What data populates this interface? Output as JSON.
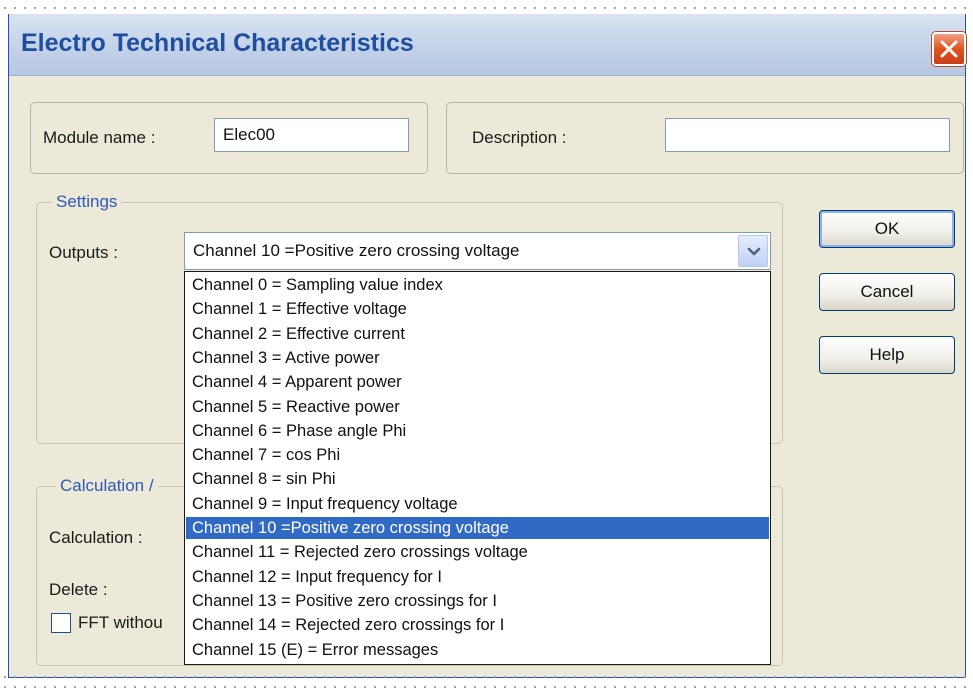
{
  "window": {
    "title": "Electro Technical Characteristics"
  },
  "module": {
    "name_label": "Module name :",
    "name_value": "Elec00",
    "description_label": "Description :",
    "description_value": ""
  },
  "settings": {
    "legend": "Settings",
    "outputs_label": "Outputs :",
    "selected_output": "Channel 10 =Positive zero crossing voltage"
  },
  "dropdown": {
    "items": [
      "Channel 0 = Sampling value index",
      "Channel 1 = Effective voltage",
      "Channel 2 = Effective current",
      "Channel 3 = Active power",
      "Channel 4 = Apparent power",
      "Channel 5 = Reactive power",
      "Channel 6 = Phase angle Phi",
      "Channel 7 = cos Phi",
      "Channel 8 = sin Phi",
      "Channel 9 = Input frequency voltage",
      "Channel 10 =Positive zero crossing voltage",
      "Channel 11 = Rejected zero crossings voltage",
      "Channel 12 = Input frequency for I",
      "Channel 13 = Positive zero crossings for I",
      "Channel 14 = Rejected zero crossings for I",
      "Channel 15 (E) = Error messages"
    ],
    "selected_index": 10
  },
  "calculation": {
    "legend_partial": "Calculation /",
    "calculation_label": "Calculation :",
    "delete_label": "Delete :",
    "fft_checkbox_label": "FFT withou",
    "fft_checked": false
  },
  "buttons": {
    "ok": "OK",
    "cancel": "Cancel",
    "help": "Help"
  },
  "colors": {
    "title_text": "#1d4f9e",
    "selection": "#316ac5",
    "legend_text": "#2d59b8",
    "close_button": "#e0541e"
  }
}
